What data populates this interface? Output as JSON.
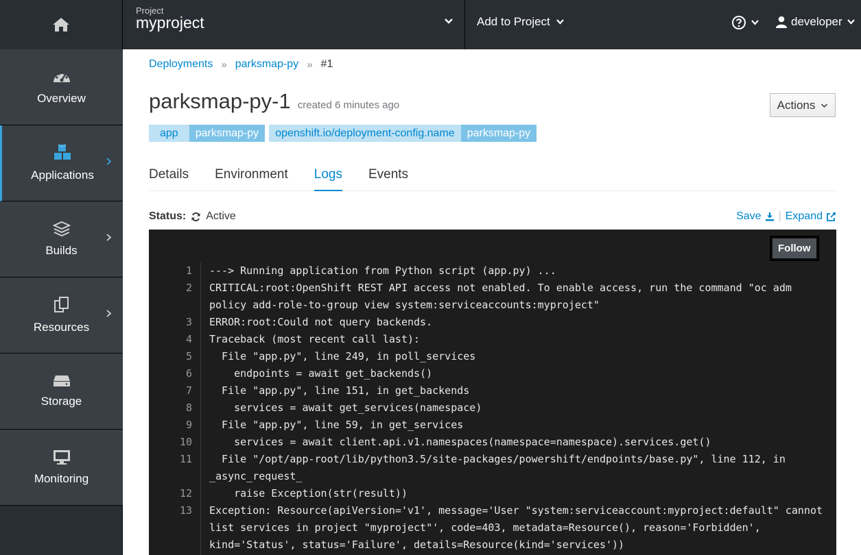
{
  "topbar": {
    "project_label": "Project",
    "project_name": "myproject",
    "add_to_project": "Add to Project",
    "user": "developer"
  },
  "sidebar": {
    "items": [
      {
        "label": "Overview",
        "icon": "dashboard-icon"
      },
      {
        "label": "Applications",
        "icon": "cubes-icon"
      },
      {
        "label": "Builds",
        "icon": "layers-icon"
      },
      {
        "label": "Resources",
        "icon": "files-icon"
      },
      {
        "label": "Storage",
        "icon": "hard-drive-icon"
      },
      {
        "label": "Monitoring",
        "icon": "monitor-icon"
      }
    ]
  },
  "breadcrumb": {
    "items": [
      "Deployments",
      "parksmap-py",
      "#1"
    ]
  },
  "page": {
    "title": "parksmap-py-1",
    "created": "created 6 minutes ago",
    "actions": "Actions"
  },
  "labels": [
    {
      "key": "app",
      "value": "parksmap-py"
    },
    {
      "key": "openshift.io/deployment-config.name",
      "value": "parksmap-py"
    }
  ],
  "tabs": [
    "Details",
    "Environment",
    "Logs",
    "Events"
  ],
  "status": {
    "label": "Status:",
    "value": "Active"
  },
  "log_actions": {
    "save": "Save",
    "expand": "Expand",
    "follow": "Follow"
  },
  "log": {
    "lines": [
      {
        "n": "1",
        "t": "---> Running application from Python script (app.py) ..."
      },
      {
        "n": "2",
        "t": "CRITICAL:root:OpenShift REST API access not enabled. To enable access, run the command \"oc adm"
      },
      {
        "n": "",
        "t": "policy add-role-to-group view system:serviceaccounts:myproject\""
      },
      {
        "n": "3",
        "t": "ERROR:root:Could not query backends."
      },
      {
        "n": "4",
        "t": "Traceback (most recent call last):"
      },
      {
        "n": "5",
        "t": "  File \"app.py\", line 249, in poll_services"
      },
      {
        "n": "6",
        "t": "    endpoints = await get_backends()"
      },
      {
        "n": "7",
        "t": "  File \"app.py\", line 151, in get_backends"
      },
      {
        "n": "8",
        "t": "    services = await get_services(namespace)"
      },
      {
        "n": "9",
        "t": "  File \"app.py\", line 59, in get_services"
      },
      {
        "n": "10",
        "t": "    services = await client.api.v1.namespaces(namespace=namespace).services.get()"
      },
      {
        "n": "11",
        "t": "  File \"/opt/app-root/lib/python3.5/site-packages/powershift/endpoints/base.py\", line 112, in"
      },
      {
        "n": "",
        "t": "_async_request_"
      },
      {
        "n": "12",
        "t": "    raise Exception(str(result))"
      },
      {
        "n": "13",
        "t": "Exception: Resource(apiVersion='v1', message='User \"system:serviceaccount:myproject:default\" cannot"
      },
      {
        "n": "",
        "t": "list services in project \"myproject\"', code=403, metadata=Resource(), reason='Forbidden',"
      },
      {
        "n": "",
        "t": "kind='Status', status='Failure', details=Resource(kind='services'))"
      }
    ]
  }
}
